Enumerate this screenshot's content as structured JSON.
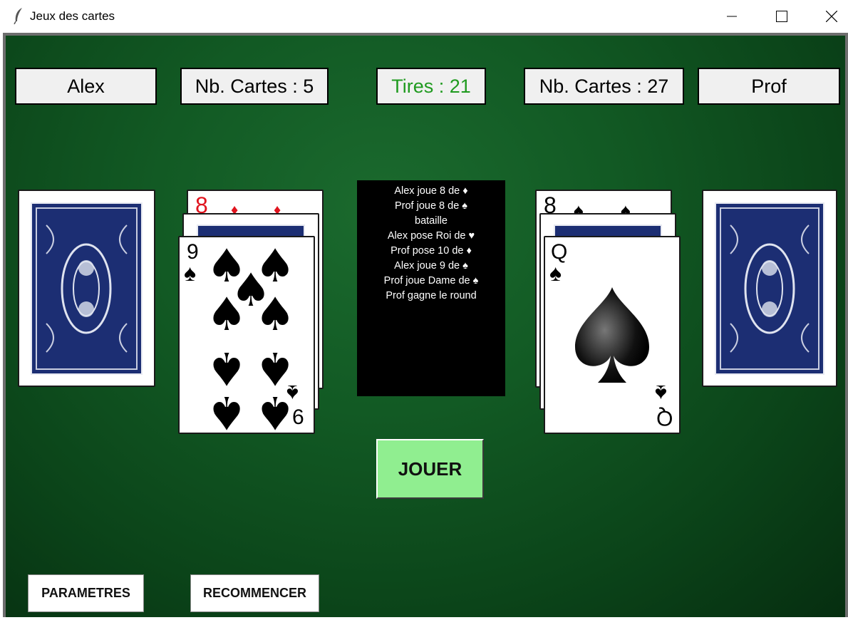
{
  "window": {
    "title": "Jeux des cartes"
  },
  "player1": {
    "name": "Alex",
    "cards_label": "Nb. Cartes : 5"
  },
  "player2": {
    "name": "Prof",
    "cards_label": "Nb. Cartes : 27"
  },
  "tires_label": "Tires : 21",
  "colors": {
    "tires_text": "#1f9a1f",
    "felt": "#125a24",
    "jouer_bg": "#90ee90",
    "card_back": "#1c2e73"
  },
  "log": [
    "Alex joue 8 de ♦",
    "Prof joue 8 de ♠",
    "bataille",
    "Alex pose Roi de ♥",
    "Prof pose 10 de ♦",
    "Alex joue 9 de ♠",
    "Prof joue Dame de ♠",
    "Prof gagne le round"
  ],
  "left_pile": {
    "back_card": {
      "rank": "8",
      "suit": "♦"
    },
    "face_card": {
      "rank_top": "9",
      "rank_bottom": "6",
      "suit": "♠"
    }
  },
  "right_pile": {
    "back_card": {
      "rank": "8",
      "suit": "♠"
    },
    "face_card": {
      "rank_top": "Q",
      "rank_bottom": "Q",
      "suit": "♠"
    }
  },
  "buttons": {
    "play": "JOUER",
    "settings": "PARAMETRES",
    "restart": "RECOMMENCER"
  },
  "icons": {
    "app": "feather-icon",
    "minimize": "minimize-icon",
    "maximize": "maximize-icon",
    "close": "close-icon"
  }
}
